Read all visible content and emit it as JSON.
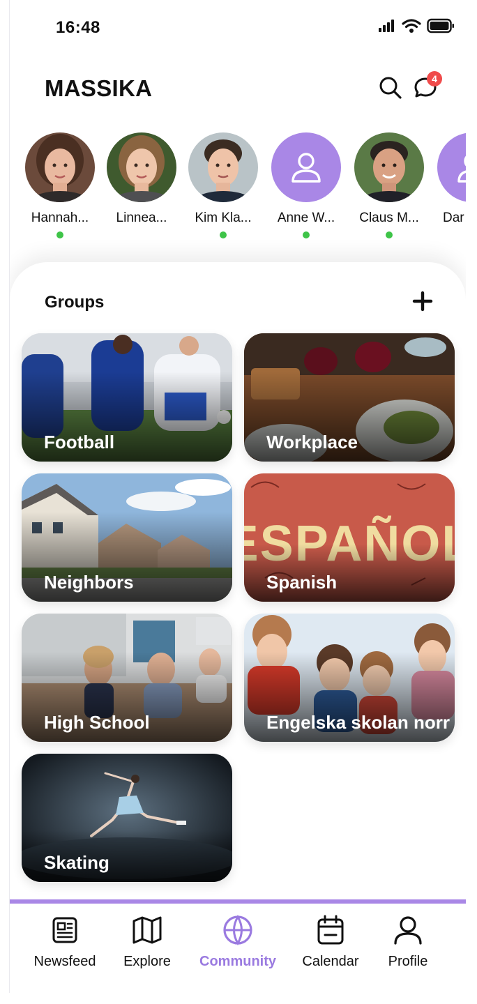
{
  "status_bar": {
    "time": "16:48"
  },
  "header": {
    "title": "MASSIKA",
    "notification_count": "4"
  },
  "people": [
    {
      "name": "Hannah...",
      "online": true,
      "avatar": "photo"
    },
    {
      "name": "Linnea...",
      "online": false,
      "avatar": "photo"
    },
    {
      "name": "Kim Kla...",
      "online": true,
      "avatar": "photo"
    },
    {
      "name": "Anne W...",
      "online": true,
      "avatar": "placeholder"
    },
    {
      "name": "Claus M...",
      "online": true,
      "avatar": "photo"
    },
    {
      "name": "Dar",
      "online": false,
      "avatar": "placeholder"
    }
  ],
  "groups": {
    "title": "Groups",
    "items": [
      {
        "name": "Football"
      },
      {
        "name": "Workplace"
      },
      {
        "name": "Neighbors"
      },
      {
        "name": "Spanish"
      },
      {
        "name": "High School"
      },
      {
        "name": "Engelska skolan norr"
      },
      {
        "name": "Skating"
      }
    ]
  },
  "tabs": [
    {
      "label": "Newsfeed",
      "icon": "newspaper-icon",
      "active": false
    },
    {
      "label": "Explore",
      "icon": "map-icon",
      "active": false
    },
    {
      "label": "Community",
      "icon": "globe-icon",
      "active": true
    },
    {
      "label": "Calendar",
      "icon": "calendar-icon",
      "active": false
    },
    {
      "label": "Profile",
      "icon": "user-icon",
      "active": false
    }
  ],
  "colors": {
    "accent": "#a987e6",
    "online": "#3ec448",
    "badge": "#f04b4b"
  }
}
